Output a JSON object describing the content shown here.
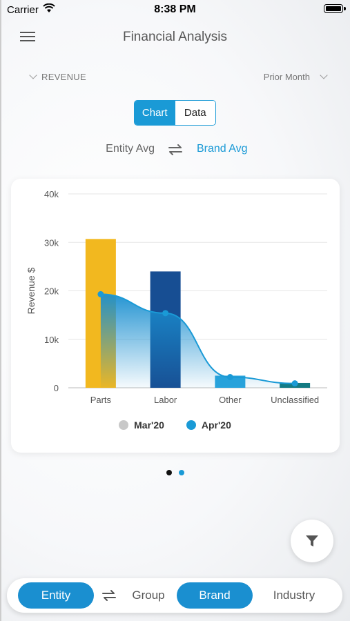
{
  "status_bar": {
    "carrier": "Carrier",
    "time": "8:38 PM"
  },
  "header": {
    "title": "Financial Analysis"
  },
  "selectors": {
    "metric": "REVENUE",
    "period": "Prior Month"
  },
  "view_toggle": {
    "chart_label": "Chart",
    "data_label": "Data",
    "selected": "Chart"
  },
  "comparison": {
    "left": "Entity Avg",
    "right": "Brand Avg",
    "active": "Brand Avg"
  },
  "chart_data": {
    "type": "bar",
    "categories": [
      "Parts",
      "Labor",
      "Other",
      "Unclassified"
    ],
    "ylabel": "Revenue $",
    "xlabel": "",
    "ylim": [
      0,
      40000
    ],
    "yticks": [
      "0",
      "10k",
      "20k",
      "30k",
      "40k"
    ],
    "ytick_values": [
      0,
      10000,
      20000,
      30000,
      40000
    ],
    "bars": [
      30700,
      24000,
      2500,
      1000
    ],
    "bar_colors": [
      "#f2b81f",
      "#174e93",
      "#29a4dc",
      "#137a82"
    ],
    "line": {
      "values": [
        19300,
        15400,
        2200,
        900
      ],
      "color": "#1a9ad6"
    },
    "legend": [
      {
        "name": "Mar'20",
        "color": "#c8c8c8"
      },
      {
        "name": "Apr'20",
        "color": "#1a9ad6"
      }
    ]
  },
  "pager": {
    "count": 2,
    "active": 0
  },
  "bottom_bar": {
    "entity": "Entity",
    "group": "Group",
    "brand": "Brand",
    "industry": "Industry"
  },
  "colors": {
    "accent": "#1a9ad6",
    "pill": "#1a8fd0"
  },
  "icons": {
    "menu": "hamburger-icon",
    "swap": "swap-arrows-icon",
    "filter": "funnel-icon"
  }
}
